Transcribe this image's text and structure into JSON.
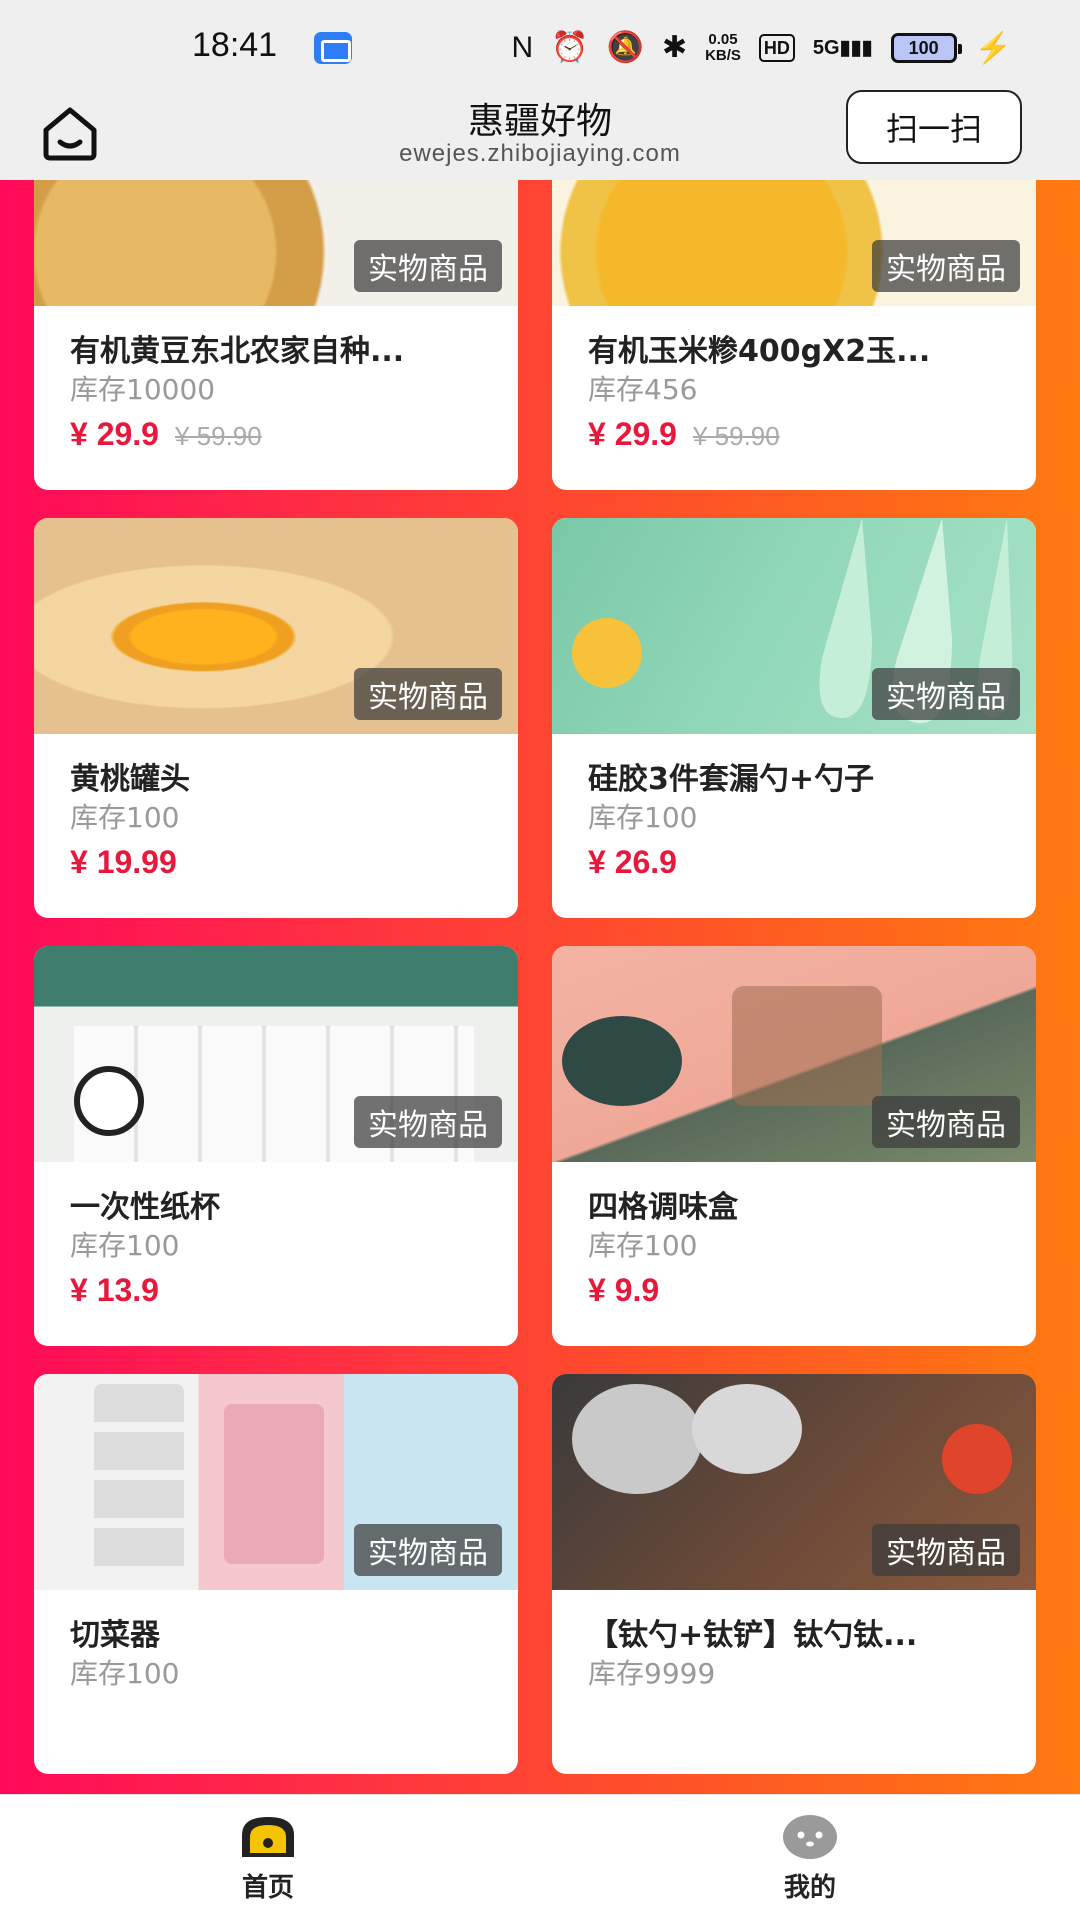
{
  "status_bar": {
    "time": "18:41",
    "network_speed_value": "0.05",
    "network_speed_unit": "KB/S",
    "hd_label": "HD",
    "signal_label": "5G",
    "battery_level": "100",
    "icons": [
      "app-icon",
      "nfc-icon",
      "alarm-icon",
      "mute-icon",
      "bluetooth-icon",
      "hd-icon",
      "signal-icon",
      "battery-icon",
      "charging-icon"
    ]
  },
  "header": {
    "title": "惠疆好物",
    "url": "ewejes.zhibojiaying.com",
    "scan_label": "扫一扫"
  },
  "products": [
    {
      "title": "有机黄豆东北农家自种...",
      "stock": "库存10000",
      "price": "¥ 29.9",
      "old_price": "¥ 59.90",
      "badge": "实物商品",
      "image": "soybean"
    },
    {
      "title": "有机玉米糁400gX2玉...",
      "stock": "库存456",
      "price": "¥ 29.9",
      "old_price": "¥ 59.90",
      "badge": "实物商品",
      "image": "corn-grits"
    },
    {
      "title": "黄桃罐头",
      "stock": "库存100",
      "price": "¥ 19.99",
      "old_price": "",
      "badge": "实物商品",
      "image": "yellow-peach"
    },
    {
      "title": "硅胶3件套漏勺+勺子",
      "stock": "库存100",
      "price": "¥ 26.9",
      "old_price": "",
      "badge": "实物商品",
      "image": "silicone-utensils"
    },
    {
      "title": "一次性纸杯",
      "stock": "库存100",
      "price": "¥ 13.9",
      "old_price": "",
      "badge": "实物商品",
      "image": "paper-cups"
    },
    {
      "title": "四格调味盒",
      "stock": "库存100",
      "price": "¥ 9.9",
      "old_price": "",
      "badge": "实物商品",
      "image": "spice-box"
    },
    {
      "title": "切菜器",
      "stock": "库存100",
      "price": "",
      "old_price": "",
      "badge": "实物商品",
      "image": "vegetable-slicer"
    },
    {
      "title": "【钛勺+钛铲】钛勺钛...",
      "stock": "库存9999",
      "price": "",
      "old_price": "",
      "badge": "实物商品",
      "image": "titanium-spoon"
    }
  ],
  "tabbar": {
    "home_label": "首页",
    "mine_label": "我的"
  },
  "colors": {
    "gradient_start": "#ff0a5a",
    "gradient_end": "#ff7a10",
    "price": "#e8173c"
  }
}
